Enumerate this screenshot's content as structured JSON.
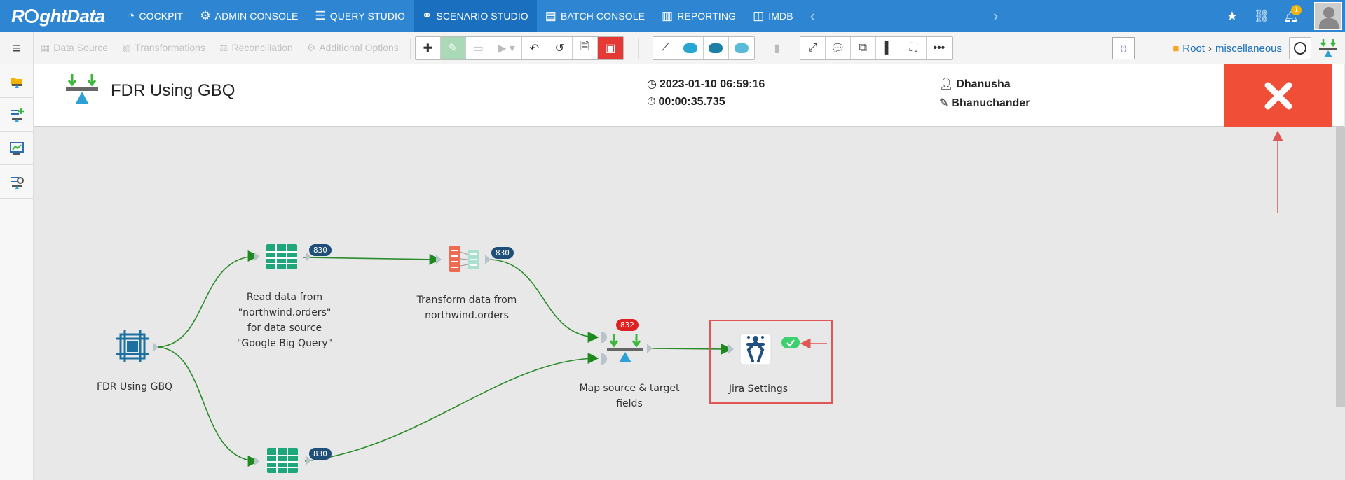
{
  "app": {
    "logo": "RightData"
  },
  "nav": {
    "items": [
      {
        "label": "COCKPIT",
        "icon": "cockpit-icon"
      },
      {
        "label": "ADMIN CONSOLE",
        "icon": "gear-icon"
      },
      {
        "label": "QUERY STUDIO",
        "icon": "database-icon"
      },
      {
        "label": "SCENARIO STUDIO",
        "icon": "scenario-icon",
        "active": true
      },
      {
        "label": "BATCH CONSOLE",
        "icon": "batch-icon"
      },
      {
        "label": "REPORTING",
        "icon": "report-icon"
      },
      {
        "label": "IMDB",
        "icon": "imdb-icon"
      }
    ],
    "notification_count": "1"
  },
  "toolbar": {
    "disabled_tabs": [
      "Data Source",
      "Transformations",
      "Reconciliation",
      "Additional Options"
    ],
    "json_label": "{:}\nJSON",
    "breadcrumb": {
      "root": "Root",
      "folder": "miscellaneous"
    }
  },
  "header": {
    "title": "FDR Using GBQ",
    "datetime": "2023-01-10 06:59:16",
    "duration": "00:00:35.735",
    "user": "Dhanusha",
    "editor": "Bhanuchander"
  },
  "flow": {
    "nodes": {
      "source": {
        "label": "FDR Using GBQ"
      },
      "read": {
        "label_lines": [
          "Read data from",
          "\"northwind.orders\"",
          "for data source",
          "\"Google Big Query\""
        ],
        "count": "830"
      },
      "transform": {
        "label_lines": [
          "Transform data from",
          "northwind.orders"
        ],
        "count": "830"
      },
      "map": {
        "label_lines": [
          "Map source & target",
          "fields"
        ],
        "count": "832"
      },
      "jira": {
        "label": "Jira Settings"
      },
      "read2": {
        "count": "830"
      }
    }
  },
  "colors": {
    "nav_bg": "#2e86d3",
    "nav_active": "#1a6fbf",
    "close_red": "#f04e37",
    "edge_green": "#2a8c2a",
    "teal_table": "#1fa67a",
    "badge_navy": "#1f4e79"
  }
}
